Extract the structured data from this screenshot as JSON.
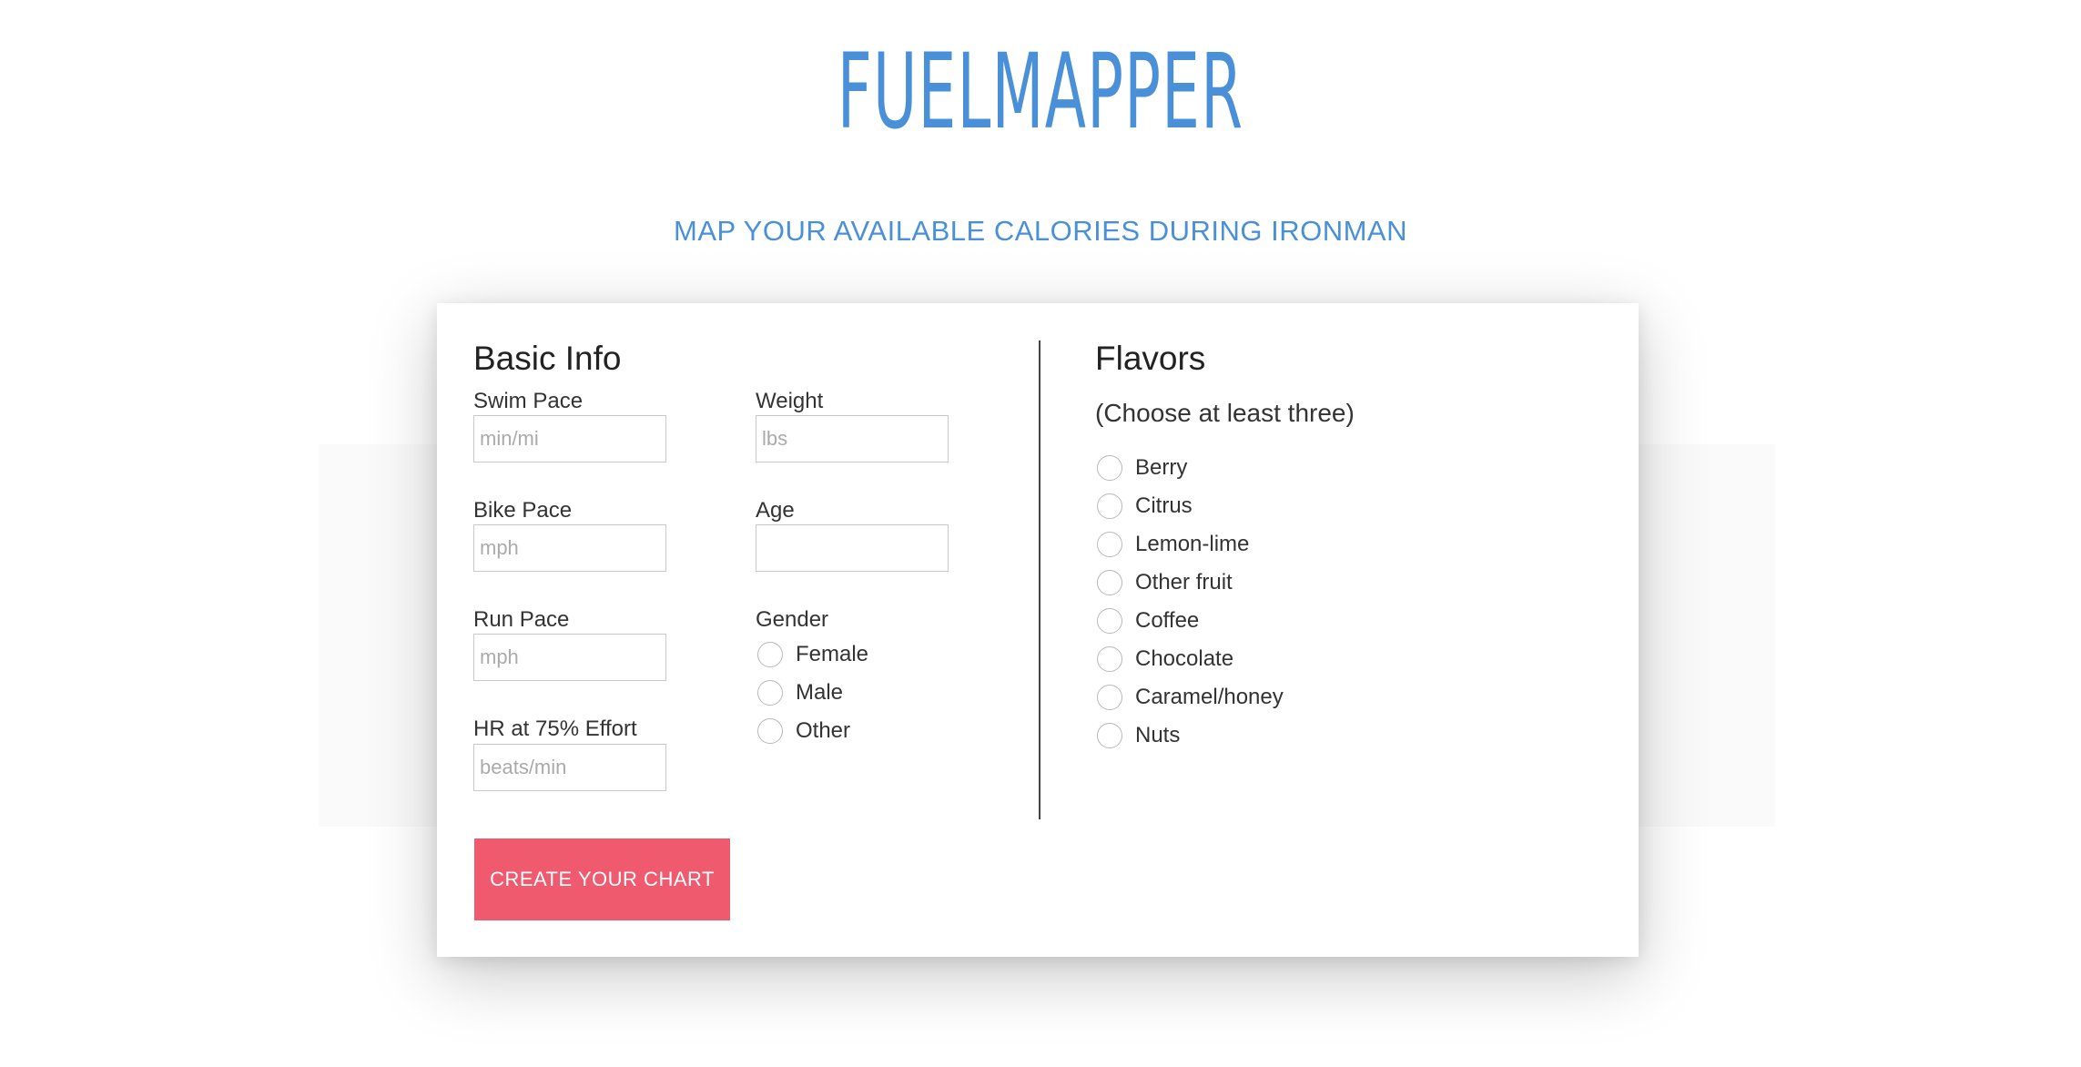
{
  "header": {
    "logo": "FUELMAPPER",
    "tagline": "MAP YOUR AVAILABLE CALORIES DURING IRONMAN"
  },
  "basic_info": {
    "title": "Basic Info",
    "swim_pace": {
      "label": "Swim Pace",
      "placeholder": "min/mi",
      "value": ""
    },
    "bike_pace": {
      "label": "Bike Pace",
      "placeholder": "mph",
      "value": ""
    },
    "run_pace": {
      "label": "Run Pace",
      "placeholder": "mph",
      "value": ""
    },
    "hr_effort": {
      "label": "HR at 75% Effort",
      "placeholder": "beats/min",
      "value": ""
    },
    "weight": {
      "label": "Weight",
      "placeholder": "lbs",
      "value": ""
    },
    "age": {
      "label": "Age",
      "placeholder": "",
      "value": ""
    },
    "gender": {
      "label": "Gender",
      "options": [
        "Female",
        "Male",
        "Other"
      ]
    }
  },
  "flavors": {
    "title": "Flavors",
    "hint": "(Choose at least three)",
    "options": [
      "Berry",
      "Citrus",
      "Lemon-lime",
      "Other fruit",
      "Coffee",
      "Chocolate",
      "Caramel/honey",
      "Nuts"
    ]
  },
  "actions": {
    "create_label": "CREATE YOUR CHART"
  },
  "colors": {
    "brand_blue": "#4a90d9",
    "cta_red": "#ef5a6f"
  }
}
